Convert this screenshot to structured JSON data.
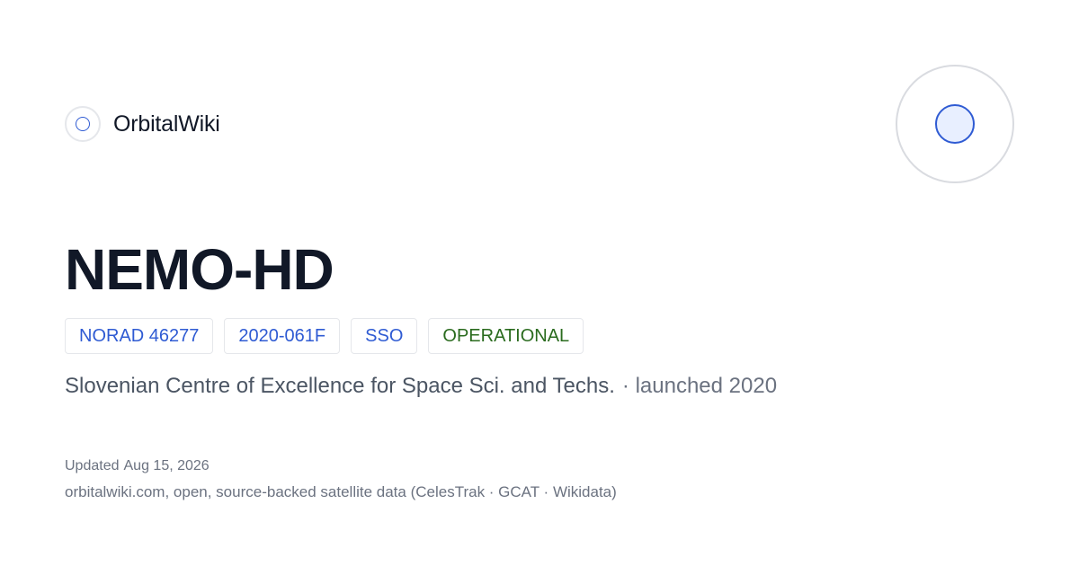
{
  "brand": {
    "name": "OrbitalWiki",
    "logo_icon": "orbit-ring-icon",
    "accent_color": "#2f5bd3"
  },
  "hero_icon": "satellite-orbit-icon",
  "satellite": {
    "name": "NEMO-HD",
    "norad": "NORAD 46277",
    "cospar": "2020-061F",
    "orbit": "SSO",
    "status": "OPERATIONAL",
    "status_color": "#2a6b1e",
    "operator": "Slovenian Centre of Excellence for Space Sci. and Techs.",
    "launch": "· launched 2020"
  },
  "footer": {
    "updated_label": "Updated",
    "updated_date": "Aug 15, 2026",
    "source": "orbitalwiki.com, open, source-backed satellite data (CelesTrak · GCAT · Wikidata)"
  }
}
